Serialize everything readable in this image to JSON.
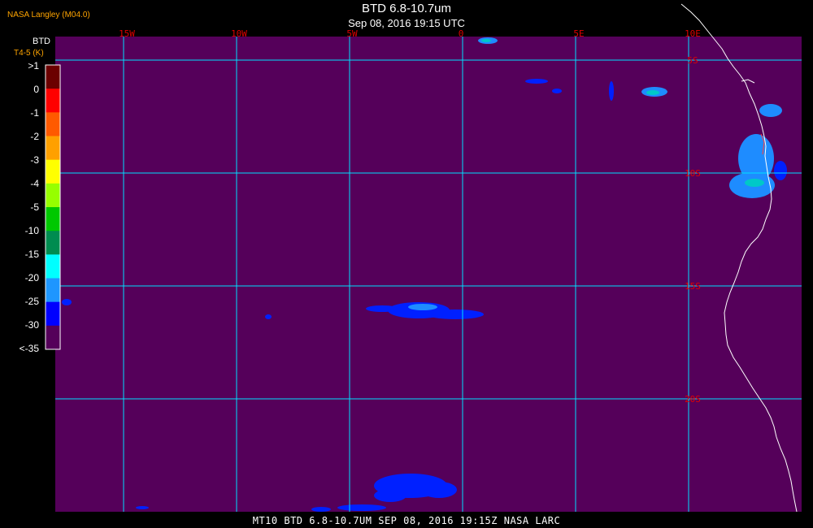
{
  "header": {
    "producer": "NASA Langley (M04.0)",
    "title": "BTD 6.8-10.7um",
    "subtitle": "Sep 08, 2016 19:15 UTC"
  },
  "colorbar": {
    "title": "BTD",
    "unit": "T4-5 (K)",
    "labels": [
      ">1",
      "0",
      "-1",
      "-2",
      "-3",
      "-4",
      "-5",
      "-10",
      "-15",
      "-20",
      "-25",
      "-30",
      "<-35"
    ],
    "colors": [
      "#6b0000",
      "#ff0000",
      "#ff5a00",
      "#ffa000",
      "#ffff00",
      "#96ff00",
      "#00c800",
      "#008c50",
      "#00ffff",
      "#1e96ff",
      "#0000ff",
      "#55005a"
    ]
  },
  "map": {
    "background_color": "#55005a",
    "grid_color": "#00e0ff",
    "coast_color": "#ffffff",
    "lon_labels": [
      "15W",
      "10W",
      "5W",
      "0",
      "5E",
      "10E"
    ],
    "lat_labels": [
      "5S",
      "10S",
      "15S",
      "20S"
    ],
    "label_color": "#e00000"
  },
  "footer": {
    "text": "MT10  BTD 6.8-10.7UM  SEP 08, 2016 19:15Z  NASA LARC"
  }
}
